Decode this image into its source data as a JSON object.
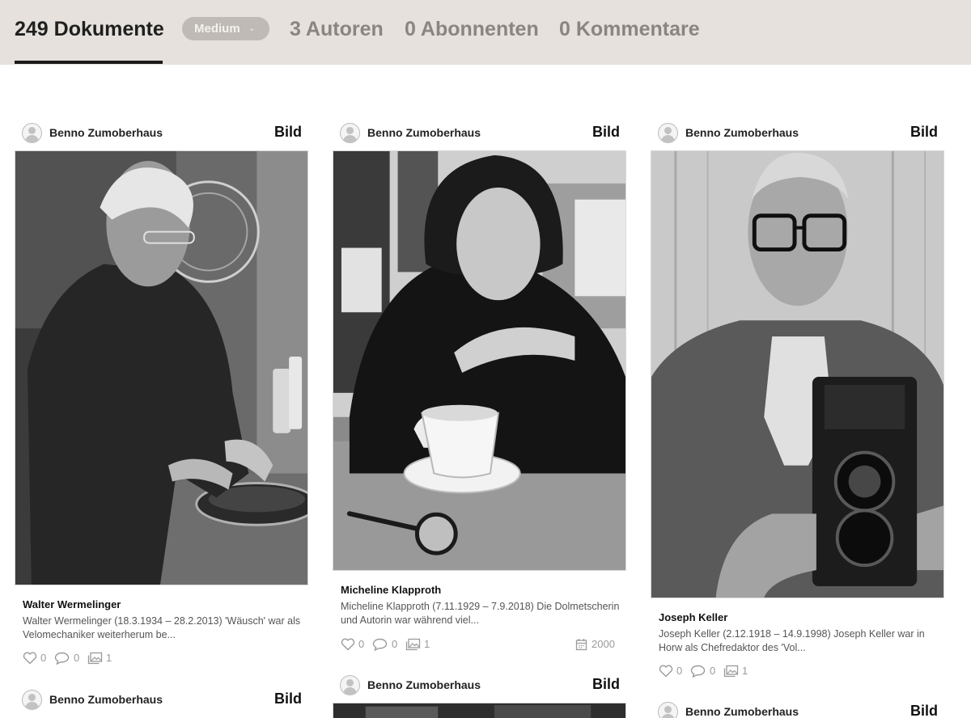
{
  "tabs": {
    "documents": "249 Dokumente",
    "medium_select": "Medium",
    "authors": "3 Autoren",
    "subscribers": "0 Abonnenten",
    "comments": "0 Kommentare"
  },
  "cards": [
    {
      "author": "Benno Zumoberhaus",
      "type": "Bild",
      "title": "Walter Wermelinger",
      "description": "Walter Wermelinger (18.3.1934 – 28.2.2013) 'Wäusch' war als Velomechaniker weiterherum be...",
      "likes": "0",
      "comments": "0",
      "images": "1"
    },
    {
      "author": "Benno Zumoberhaus",
      "type": "Bild",
      "title": "Micheline Klapproth",
      "description": "Micheline Klapproth (7.11.1929 – 7.9.2018) Die Dolmetscherin und Autorin war während viel...",
      "likes": "0",
      "comments": "0",
      "images": "1",
      "year": "2000"
    },
    {
      "author": "Benno Zumoberhaus",
      "type": "Bild",
      "title": "Joseph Keller",
      "description": "Joseph Keller (2.12.1918 – 14.9.1998) Joseph Keller war in Horw als Chefredaktor des 'Vol...",
      "likes": "0",
      "comments": "0",
      "images": "1"
    },
    {
      "author": "Benno Zumoberhaus",
      "type": "Bild"
    },
    {
      "author": "Benno Zumoberhaus",
      "type": "Bild"
    },
    {
      "author": "Benno Zumoberhaus",
      "type": "Bild"
    }
  ],
  "icons": {
    "like": "heart-icon",
    "comment": "comment-bubble-icon",
    "images": "image-stack-icon",
    "year": "calendar-icon",
    "avatar": "user-avatar-icon",
    "dropdown": "chevron-down-icon"
  },
  "colors": {
    "topbar": "#e6e1dc",
    "select_bg": "#bfbab5",
    "active_tab": "#1f1f1f",
    "inactive_tab": "#8a8580"
  }
}
